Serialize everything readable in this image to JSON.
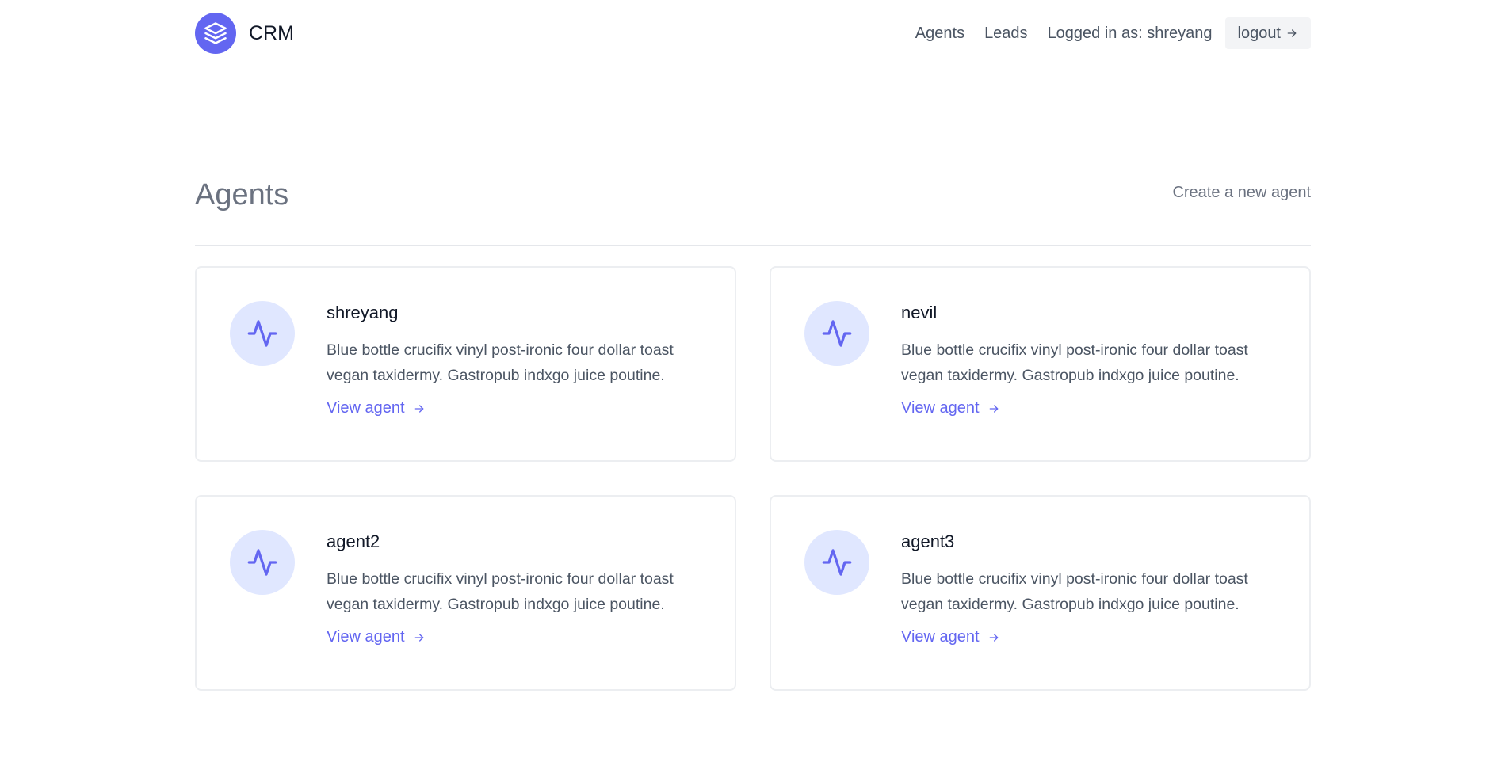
{
  "brand": {
    "name": "CRM"
  },
  "nav": {
    "agents": "Agents",
    "leads": "Leads",
    "logged_in": "Logged in as: shreyang",
    "logout": "logout"
  },
  "page": {
    "title": "Agents",
    "create_link": "Create a new agent"
  },
  "agents": [
    {
      "name": "shreyang",
      "description": "Blue bottle crucifix vinyl post-ironic four dollar toast vegan taxidermy. Gastropub indxgo juice poutine.",
      "link": "View agent"
    },
    {
      "name": "nevil",
      "description": "Blue bottle crucifix vinyl post-ironic four dollar toast vegan taxidermy. Gastropub indxgo juice poutine.",
      "link": "View agent"
    },
    {
      "name": "agent2",
      "description": "Blue bottle crucifix vinyl post-ironic four dollar toast vegan taxidermy. Gastropub indxgo juice poutine.",
      "link": "View agent"
    },
    {
      "name": "agent3",
      "description": "Blue bottle crucifix vinyl post-ironic four dollar toast vegan taxidermy. Gastropub indxgo juice poutine.",
      "link": "View agent"
    }
  ],
  "icons": {
    "logo": "stack-layers-icon",
    "agent_avatar": "pulse-activity-icon",
    "arrow": "arrow-right-icon"
  },
  "colors": {
    "accent": "#6366f1",
    "avatar_bg": "#e0e7ff",
    "logout_bg": "#f3f4f6"
  }
}
